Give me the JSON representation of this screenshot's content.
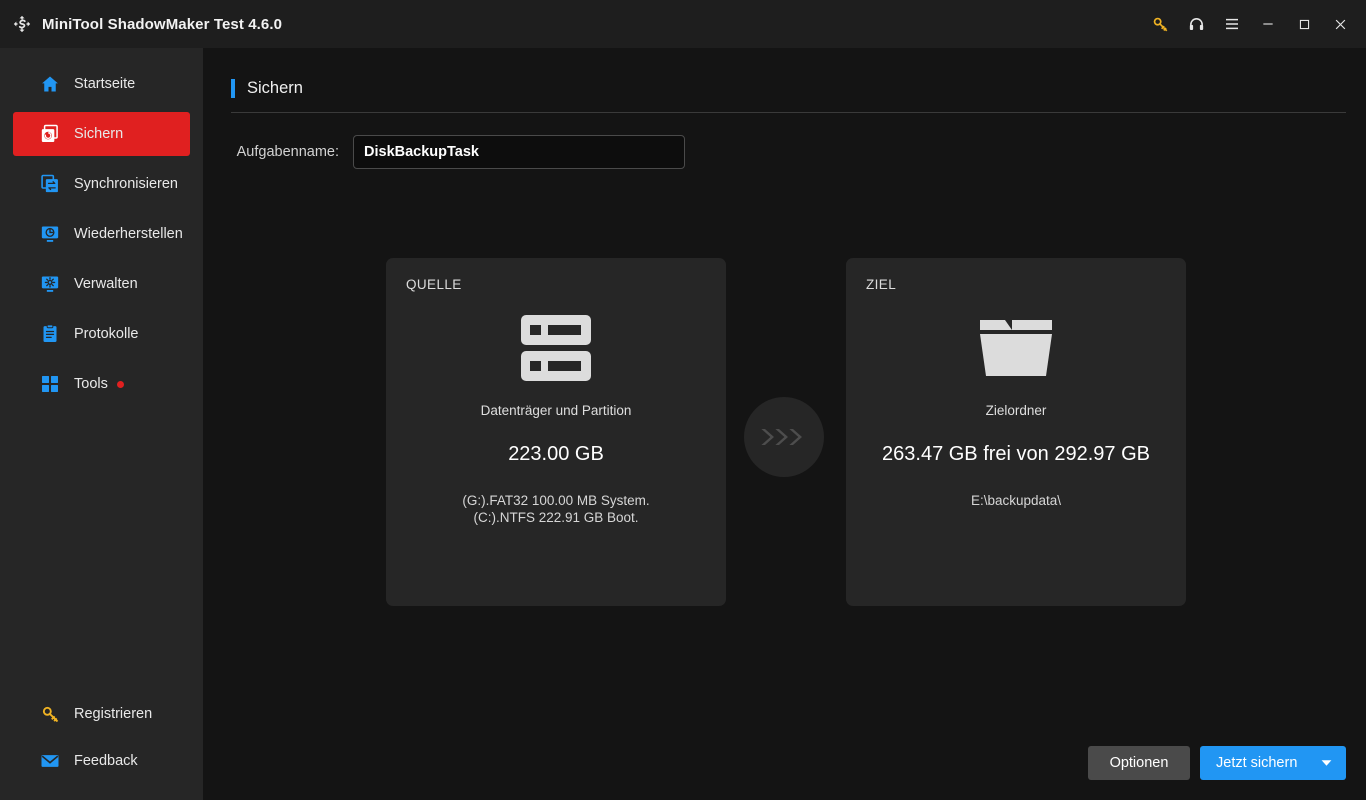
{
  "window": {
    "title": "MiniTool ShadowMaker Test 4.6.0",
    "logo_icon": "shadowmaker-logo-icon",
    "controls": [
      {
        "name": "key-icon",
        "label": "Registrieren"
      },
      {
        "name": "headset-icon",
        "label": "Support"
      },
      {
        "name": "hamburger-menu-icon",
        "label": "Menü"
      },
      {
        "name": "minimize-icon",
        "label": "Minimieren"
      },
      {
        "name": "maximize-icon",
        "label": "Maximieren"
      },
      {
        "name": "close-icon",
        "label": "Schließen"
      }
    ]
  },
  "sidebar": {
    "items": [
      {
        "label": "Startseite",
        "icon": "home-icon",
        "active": false,
        "dot": false
      },
      {
        "label": "Sichern",
        "icon": "backup-icon",
        "active": true,
        "dot": false
      },
      {
        "label": "Synchronisieren",
        "icon": "sync-icon",
        "active": false,
        "dot": false
      },
      {
        "label": "Wiederherstellen",
        "icon": "restore-icon",
        "active": false,
        "dot": false
      },
      {
        "label": "Verwalten",
        "icon": "manage-icon",
        "active": false,
        "dot": false
      },
      {
        "label": "Protokolle",
        "icon": "logs-icon",
        "active": false,
        "dot": false
      },
      {
        "label": "Tools",
        "icon": "tools-icon",
        "active": false,
        "dot": true
      }
    ],
    "bottom_items": [
      {
        "label": "Registrieren",
        "icon": "key-icon"
      },
      {
        "label": "Feedback",
        "icon": "envelope-icon"
      }
    ]
  },
  "main": {
    "page_title": "Sichern",
    "task": {
      "label": "Aufgabenname:",
      "value": "DiskBackupTask",
      "placeholder": "Aufgabenname"
    },
    "source": {
      "kicker": "QUELLE",
      "icon": "disk-partition-icon",
      "type": "Datenträger und Partition",
      "size": "223.00 GB",
      "details": [
        "(G:).FAT32 100.00 MB System.",
        "(C:).NTFS 222.91 GB Boot."
      ]
    },
    "arrow": {
      "icon": "triple-chevron-right-icon"
    },
    "target": {
      "kicker": "ZIEL",
      "icon": "folder-icon",
      "type": "Zielordner",
      "size": "263.47 GB frei von 292.97 GB",
      "details": [
        "E:\\backupdata\\"
      ]
    },
    "footer": {
      "options_label": "Optionen",
      "backup_label": "Jetzt sichern",
      "caret_icon": "caret-down-icon"
    }
  },
  "colors": {
    "accent_blue": "#2196f3",
    "active_red": "#e02020",
    "key_yellow": "#f0b323",
    "sidebar_bg": "#262626",
    "main_bg": "#141414",
    "titlebar_bg": "#1e1e1e"
  }
}
